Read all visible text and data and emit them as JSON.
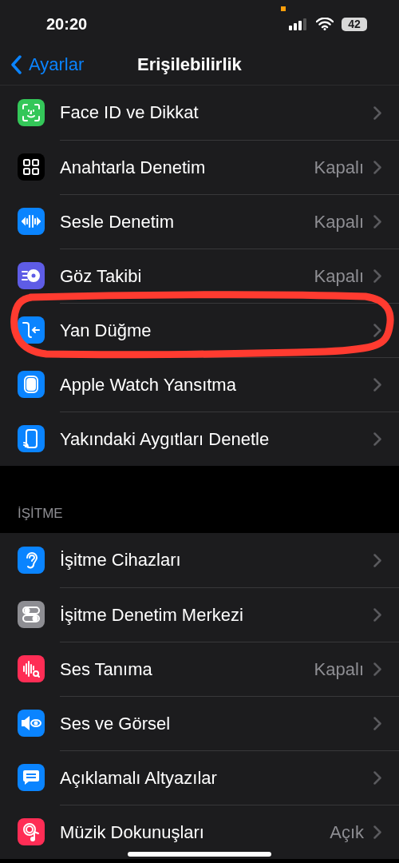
{
  "status_bar": {
    "time": "20:20",
    "battery": "42"
  },
  "nav": {
    "back": "Ayarlar",
    "title": "Erişilebilirlik"
  },
  "sections": [
    {
      "items": [
        {
          "label": "Face ID ve Dikkat",
          "value": null,
          "color": "#34c759"
        },
        {
          "label": "Anahtarla Denetim",
          "value": "Kapalı",
          "color": "#000000"
        },
        {
          "label": "Sesle Denetim",
          "value": "Kapalı",
          "color": "#0a84ff"
        },
        {
          "label": "Göz Takibi",
          "value": "Kapalı",
          "color": "#5e5ce6"
        },
        {
          "label": "Yan Düğme",
          "value": null,
          "color": "#0a84ff"
        },
        {
          "label": "Apple Watch Yansıtma",
          "value": null,
          "color": "#0a84ff"
        },
        {
          "label": "Yakındaki Aygıtları Denetle",
          "value": null,
          "color": "#0a84ff"
        }
      ]
    },
    {
      "header": "İŞİTME",
      "items": [
        {
          "label": "İşitme Cihazları",
          "value": null,
          "color": "#0a84ff"
        },
        {
          "label": "İşitme Denetim Merkezi",
          "value": null,
          "color": "#8e8e93"
        },
        {
          "label": "Ses Tanıma",
          "value": "Kapalı",
          "color": "#ff2d55"
        },
        {
          "label": "Ses ve Görsel",
          "value": null,
          "color": "#0a84ff"
        },
        {
          "label": "Açıklamalı Altyazılar",
          "value": null,
          "color": "#0a84ff"
        },
        {
          "label": "Müzik Dokunuşları",
          "value": "Açık",
          "color": "#ff2d55"
        }
      ]
    }
  ]
}
